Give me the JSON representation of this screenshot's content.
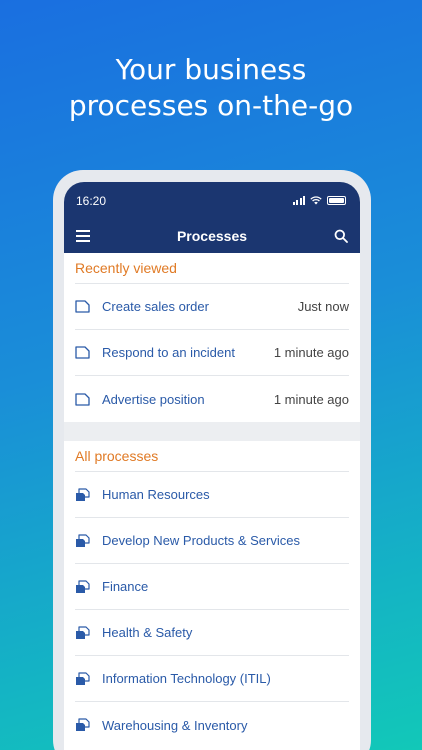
{
  "headline": {
    "line1": "Your business",
    "line2": "processes on-the-go"
  },
  "status_bar": {
    "time": "16:20"
  },
  "app_bar": {
    "title": "Processes",
    "menu_icon": "hamburger-icon",
    "search_icon": "search-icon"
  },
  "recently_viewed": {
    "header": "Recently viewed",
    "items": [
      {
        "label": "Create sales order",
        "time": "Just now",
        "icon": "document-icon"
      },
      {
        "label": "Respond to an incident",
        "time": "1 minute ago",
        "icon": "document-icon"
      },
      {
        "label": "Advertise position",
        "time": "1 minute ago",
        "icon": "document-icon"
      }
    ]
  },
  "all_processes": {
    "header": "All processes",
    "items": [
      {
        "label": "Human Resources",
        "icon": "process-group-icon"
      },
      {
        "label": "Develop New Products & Services",
        "icon": "process-group-icon"
      },
      {
        "label": "Finance",
        "icon": "process-group-icon"
      },
      {
        "label": "Health & Safety",
        "icon": "process-group-icon"
      },
      {
        "label": "Information Technology (ITIL)",
        "icon": "process-group-icon"
      },
      {
        "label": "Warehousing & Inventory",
        "icon": "process-group-icon"
      }
    ]
  },
  "colors": {
    "appbar": "#1b3670",
    "accent_orange": "#e07a25",
    "link_blue": "#2a5aa8"
  }
}
